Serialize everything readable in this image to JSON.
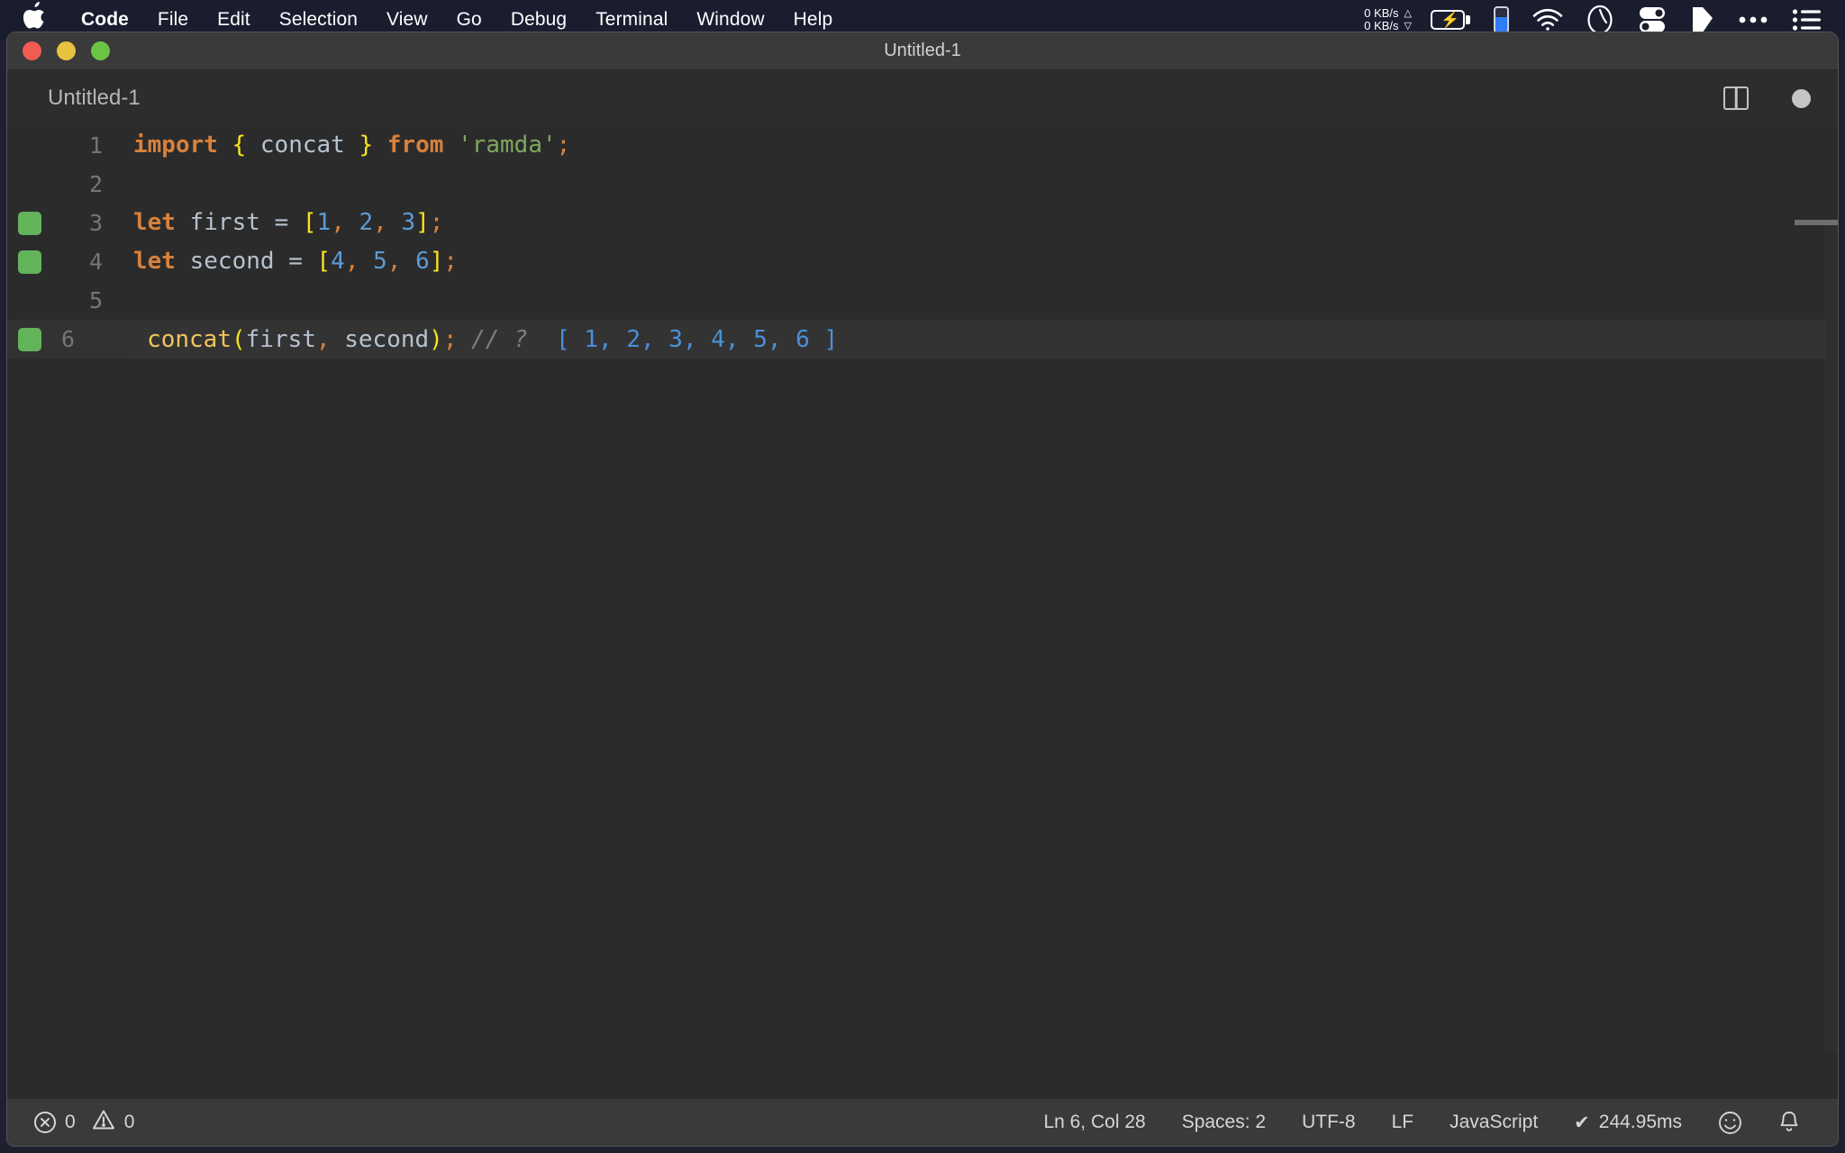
{
  "menubar": {
    "apple_glyph": "●",
    "items": [
      {
        "label": "Code",
        "bold": true
      },
      {
        "label": "File",
        "bold": false
      },
      {
        "label": "Edit",
        "bold": false
      },
      {
        "label": "Selection",
        "bold": false
      },
      {
        "label": "View",
        "bold": false
      },
      {
        "label": "Go",
        "bold": false
      },
      {
        "label": "Debug",
        "bold": false
      },
      {
        "label": "Terminal",
        "bold": false
      },
      {
        "label": "Window",
        "bold": false
      },
      {
        "label": "Help",
        "bold": false
      }
    ],
    "status_items": {
      "net_up": "0 KB/s",
      "net_down": "0 KB/s",
      "up_arrow": "△",
      "down_arrow": "▽",
      "battery_icon": "battery-charging-icon",
      "phone_battery_icon": "phone-battery-icon",
      "wifi_icon": "wifi-icon",
      "wifi_glyph": "◝",
      "clock_icon": "clock-icon",
      "toggles_icon": "toggles-icon",
      "tag_icon": "tag-icon",
      "overflow_icon": "ellipsis-icon",
      "overflow_glyph": "•••",
      "list_icon": "list-icon"
    }
  },
  "window": {
    "title": "Untitled-1",
    "traffic_lights": [
      "close",
      "minimize",
      "zoom"
    ],
    "colors": {
      "close": "#f15b52",
      "minimize": "#e8c13f",
      "zoom": "#6cc444"
    }
  },
  "editor": {
    "tab_label": "Untitled-1",
    "split_editor_icon": "split-editor-icon",
    "dirty_indicator_icon": "unsaved-dot-icon",
    "lines": [
      {
        "number": "1",
        "marker": false,
        "active": false,
        "tokens": [
          {
            "t": "import",
            "c": "kw"
          },
          {
            "t": " ",
            "c": "plain"
          },
          {
            "t": "{",
            "c": "brc"
          },
          {
            "t": " ",
            "c": "plain"
          },
          {
            "t": "concat",
            "c": "id"
          },
          {
            "t": " ",
            "c": "plain"
          },
          {
            "t": "}",
            "c": "brc"
          },
          {
            "t": " ",
            "c": "plain"
          },
          {
            "t": "from",
            "c": "kw"
          },
          {
            "t": " ",
            "c": "plain"
          },
          {
            "t": "'ramda'",
            "c": "str"
          },
          {
            "t": ";",
            "c": "punc"
          }
        ]
      },
      {
        "number": "2",
        "marker": false,
        "active": false,
        "tokens": []
      },
      {
        "number": "3",
        "marker": true,
        "active": false,
        "tokens": [
          {
            "t": "let",
            "c": "kw"
          },
          {
            "t": " ",
            "c": "plain"
          },
          {
            "t": "first",
            "c": "id"
          },
          {
            "t": " ",
            "c": "plain"
          },
          {
            "t": "=",
            "c": "plain"
          },
          {
            "t": " ",
            "c": "plain"
          },
          {
            "t": "[",
            "c": "brc"
          },
          {
            "t": "1",
            "c": "num"
          },
          {
            "t": ",",
            "c": "punc"
          },
          {
            "t": " ",
            "c": "plain"
          },
          {
            "t": "2",
            "c": "num"
          },
          {
            "t": ",",
            "c": "punc"
          },
          {
            "t": " ",
            "c": "plain"
          },
          {
            "t": "3",
            "c": "num"
          },
          {
            "t": "]",
            "c": "brc"
          },
          {
            "t": ";",
            "c": "punc"
          }
        ]
      },
      {
        "number": "4",
        "marker": true,
        "active": false,
        "tokens": [
          {
            "t": "let",
            "c": "kw"
          },
          {
            "t": " ",
            "c": "plain"
          },
          {
            "t": "second",
            "c": "id"
          },
          {
            "t": " ",
            "c": "plain"
          },
          {
            "t": "=",
            "c": "plain"
          },
          {
            "t": " ",
            "c": "plain"
          },
          {
            "t": "[",
            "c": "brc"
          },
          {
            "t": "4",
            "c": "num"
          },
          {
            "t": ",",
            "c": "punc"
          },
          {
            "t": " ",
            "c": "plain"
          },
          {
            "t": "5",
            "c": "num"
          },
          {
            "t": ",",
            "c": "punc"
          },
          {
            "t": " ",
            "c": "plain"
          },
          {
            "t": "6",
            "c": "num"
          },
          {
            "t": "]",
            "c": "brc"
          },
          {
            "t": ";",
            "c": "punc"
          }
        ]
      },
      {
        "number": "5",
        "marker": false,
        "active": false,
        "tokens": []
      },
      {
        "number": "6",
        "marker": true,
        "active": true,
        "tokens": [
          {
            "t": "concat",
            "c": "fn"
          },
          {
            "t": "(",
            "c": "brc"
          },
          {
            "t": "first",
            "c": "id"
          },
          {
            "t": ",",
            "c": "punc"
          },
          {
            "t": " ",
            "c": "plain"
          },
          {
            "t": "second",
            "c": "id"
          },
          {
            "t": ")",
            "c": "brc"
          },
          {
            "t": ";",
            "c": "punc"
          },
          {
            "t": " ",
            "c": "plain"
          },
          {
            "t": "// ?",
            "c": "cmt"
          },
          {
            "t": "  ",
            "c": "plain"
          },
          {
            "t": "[ 1, 2, 3, 4, 5, 6 ]",
            "c": "val"
          }
        ]
      }
    ],
    "colors": {
      "background": "#2b2b2b",
      "keyword": "#d8813b",
      "identifier": "#b6c2cf",
      "bracket": "#fbe41f",
      "number": "#5b9bd5",
      "string": "#7fa85f",
      "function": "#f2c55c",
      "comment": "#7f7f7f",
      "inline_value": "#4a90d9",
      "gutter_marker": "#63b35b",
      "line_number": "#767676"
    }
  },
  "statusbar": {
    "errors_icon": "error-circle-icon",
    "errors_count": "0",
    "warnings_icon": "warning-triangle-icon",
    "warnings_count": "0",
    "cursor_position": "Ln 6, Col 28",
    "indentation": "Spaces: 2",
    "encoding": "UTF-8",
    "eol": "LF",
    "language_mode": "JavaScript",
    "run_check_glyph": "✔",
    "run_time": "244.95ms",
    "feedback_icon": "smiley-icon",
    "feedback_glyph": "☺",
    "notifications_icon": "bell-icon"
  }
}
